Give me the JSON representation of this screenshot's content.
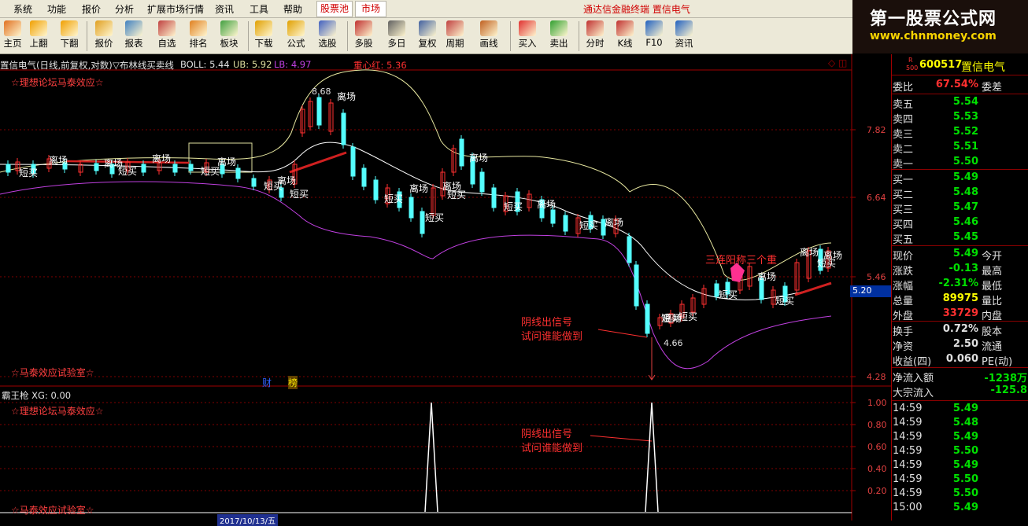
{
  "menu": {
    "items": [
      "系统",
      "功能",
      "报价",
      "分析",
      "扩展市场行情",
      "资讯",
      "工具",
      "帮助"
    ],
    "tabs": [
      "股票池",
      "市场"
    ],
    "brand": "通达信金融终端 置信电气"
  },
  "toolbar": {
    "buttons": [
      {
        "label": "主页",
        "icon": "home-icon",
        "color": "#e07020"
      },
      {
        "label": "上翻",
        "icon": "arrow-up-icon",
        "color": "#f0a000"
      },
      {
        "label": "下翻",
        "icon": "arrow-down-icon",
        "color": "#f0a000"
      },
      {
        "label": "报价",
        "icon": "yen-icon",
        "color": "#e0a020"
      },
      {
        "label": "报表",
        "icon": "report-icon",
        "color": "#4080c0"
      },
      {
        "label": "自选",
        "icon": "f6-icon",
        "color": "#c04040"
      },
      {
        "label": "排名",
        "icon": "rank-icon",
        "color": "#e08020"
      },
      {
        "label": "板块",
        "icon": "block-icon",
        "color": "#40a040"
      },
      {
        "label": "下载",
        "icon": "download-icon",
        "color": "#e0a000"
      },
      {
        "label": "公式",
        "icon": "formula-icon",
        "color": "#e0a000"
      },
      {
        "label": "选股",
        "icon": "select-stock-icon",
        "color": "#4060c0"
      },
      {
        "label": "多股",
        "icon": "multi-stock-icon",
        "color": "#c03030"
      },
      {
        "label": "多日",
        "icon": "clock-icon",
        "color": "#606060"
      },
      {
        "label": "复权",
        "icon": "adjust-icon",
        "color": "#4060a0"
      },
      {
        "label": "周期",
        "icon": "f8-icon",
        "color": "#c04040"
      },
      {
        "label": "画线",
        "icon": "draw-line-icon",
        "color": "#c06020"
      },
      {
        "label": "买入",
        "icon": "buy-icon",
        "color": "#e03030"
      },
      {
        "label": "卖出",
        "icon": "sell-icon",
        "color": "#30a030"
      },
      {
        "label": "分时",
        "icon": "intraday-icon",
        "color": "#c03030"
      },
      {
        "label": "K线",
        "icon": "kline-icon",
        "color": "#c03030"
      },
      {
        "label": "F10",
        "icon": "f10-icon",
        "color": "#2060c0"
      },
      {
        "label": "资讯",
        "icon": "news-icon",
        "color": "#2060c0"
      }
    ]
  },
  "logo": {
    "line1": "第一股票公式网",
    "line2": "www.chnmoney.com"
  },
  "chart": {
    "header": {
      "title": "置信电气(日线,前复权,对数)",
      "indicator": "▽布林线买卖线",
      "boll_label": "BOLL: 5.44",
      "ub_label": "UB: 5.92",
      "lb_label": "LB: 4.97",
      "center_red": "重心红: 5.36"
    },
    "price_axis": [
      "7.82",
      "6.64",
      "5.46",
      "4.28"
    ],
    "current_price_tag": "5.20",
    "annotations": {
      "forum_top": "☆理想论坛马泰效应☆",
      "lab_bottom": "☆马泰效应试验室☆",
      "signal_line1": "阴线出信号",
      "signal_line2": "试问谁能做到",
      "three_yang": "三连阳称三个重",
      "high_price": "8.68",
      "low_price": "4.66",
      "cai": "财",
      "bang": "榜",
      "buy_label": "短买",
      "exit_label": "离场"
    },
    "indicator_header": "霸王枪 XG: 0.00",
    "indicator_axis": [
      "1.00",
      "0.80",
      "0.60",
      "0.40",
      "0.20"
    ],
    "sub_annotations": {
      "forum_top": "☆理想论坛马泰效应☆",
      "lab_bottom": "☆马泰效应试验室☆",
      "signal_line1": "阴线出信号",
      "signal_line2": "试问谁能做到"
    },
    "time_axis": {
      "date_label": "2017/10/13/五"
    }
  },
  "quote": {
    "code": "600517",
    "name": "置信电气",
    "r_badge": "R",
    "r_num": "500",
    "weibi_label": "委比",
    "weibi_value": "67.54%",
    "weicha_label": "委差",
    "asks": [
      {
        "label": "卖五",
        "price": "5.54"
      },
      {
        "label": "卖四",
        "price": "5.53"
      },
      {
        "label": "卖三",
        "price": "5.52"
      },
      {
        "label": "卖二",
        "price": "5.51"
      },
      {
        "label": "卖一",
        "price": "5.50"
      }
    ],
    "bids": [
      {
        "label": "买一",
        "price": "5.49"
      },
      {
        "label": "买二",
        "price": "5.48"
      },
      {
        "label": "买三",
        "price": "5.47"
      },
      {
        "label": "买四",
        "price": "5.46"
      },
      {
        "label": "买五",
        "price": "5.45"
      }
    ],
    "stats": [
      {
        "k": "现价",
        "v": "5.49",
        "k2": "今开",
        "color": "#00e000"
      },
      {
        "k": "涨跌",
        "v": "-0.13",
        "k2": "最高",
        "color": "#00e000"
      },
      {
        "k": "涨幅",
        "v": "-2.31%",
        "k2": "最低",
        "color": "#00e000"
      },
      {
        "k": "总量",
        "v": "89975",
        "k2": "量比",
        "color": "#ffff00"
      },
      {
        "k": "外盘",
        "v": "33729",
        "k2": "内盘",
        "color": "#ff3030"
      }
    ],
    "stats2": [
      {
        "k": "换手",
        "v": "0.72%",
        "k2": "股本"
      },
      {
        "k": "净资",
        "v": "2.50",
        "k2": "流通"
      },
      {
        "k": "收益(四)",
        "v": "0.060",
        "k2": "PE(动)"
      }
    ],
    "flows": [
      {
        "k": "净流入额",
        "v": "-1238万"
      },
      {
        "k": "大宗流入",
        "v": "-125.8"
      }
    ],
    "ticks": [
      {
        "t": "14:59",
        "p": "5.49"
      },
      {
        "t": "14:59",
        "p": "5.48"
      },
      {
        "t": "14:59",
        "p": "5.49"
      },
      {
        "t": "14:59",
        "p": "5.50"
      },
      {
        "t": "14:59",
        "p": "5.49"
      },
      {
        "t": "14:59",
        "p": "5.50"
      },
      {
        "t": "14:59",
        "p": "5.50"
      },
      {
        "t": "15:00",
        "p": "5.49"
      }
    ]
  },
  "colors": {
    "up": "#ff3030",
    "down": "#54ffff",
    "mid": "#ffffff",
    "upper": "#e8e8a0",
    "lower": "#c040e0",
    "signal": "#ff3060"
  }
}
